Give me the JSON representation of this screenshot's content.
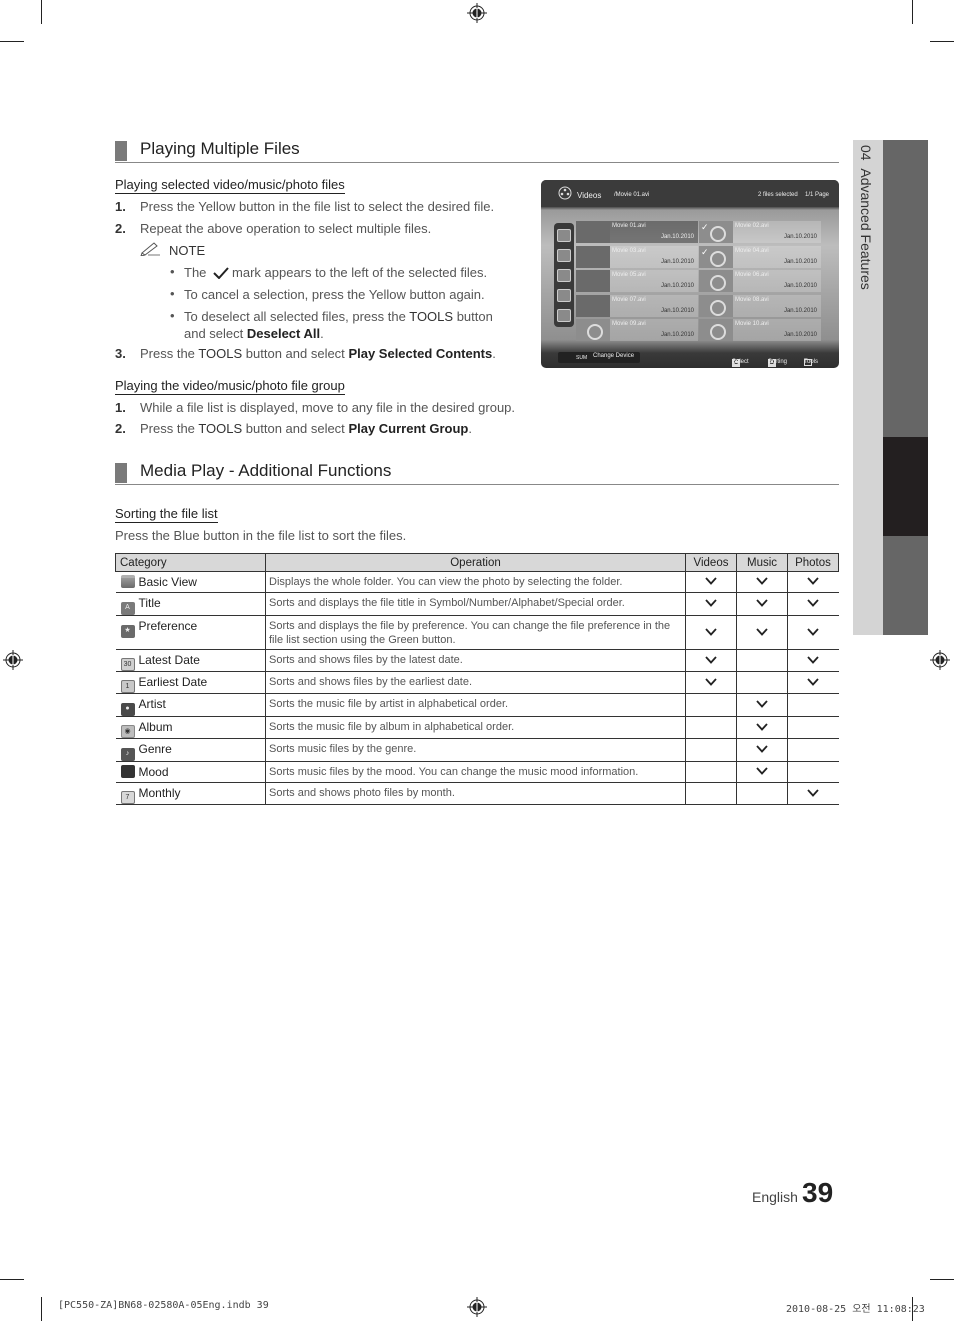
{
  "side_tab": {
    "chapter": "04",
    "title": "Advanced Features"
  },
  "section1": {
    "title": "Playing Multiple Files",
    "sub1": {
      "heading": "Playing selected video/music/photo files",
      "steps": [
        {
          "num": "1.",
          "text": "Press the Yellow button in the file list to select the desired file."
        },
        {
          "num": "2.",
          "text": "Repeat the above operation to select multiple files."
        }
      ],
      "note_label": "NOTE",
      "notes": [
        {
          "pre": "The",
          "post": "mark appears to the left of the selected files."
        },
        {
          "text": "To cancel a selection, press the Yellow button again."
        },
        {
          "pre": "To deselect all selected files, press the",
          "kw": "TOOLS",
          "post": "button",
          "line2_pre": "and select",
          "line2_bold": "Deselect All",
          "line2_post": "."
        }
      ],
      "step3": {
        "num": "3.",
        "pre": "Press the",
        "kw": "TOOLS",
        "mid": "button and select",
        "bold": "Play Selected Contents",
        "post": "."
      }
    },
    "sub2": {
      "heading": "Playing the video/music/photo file group",
      "step1": {
        "num": "1.",
        "text": "While a file list is displayed, move to any file in the desired group."
      },
      "step2": {
        "num": "2.",
        "pre": "Press the",
        "kw": "TOOLS",
        "mid": "button and select",
        "bold": "Play Current Group",
        "post": "."
      }
    }
  },
  "tv_screen": {
    "title": "Videos",
    "path": "/Movie 01.avi",
    "selected_count": "2 files selected",
    "page": "1/1 Page",
    "files": [
      {
        "name": "Movie 01.avi",
        "date": "Jan.10.2010",
        "checked": false
      },
      {
        "name": "Movie 02.avi",
        "date": "Jan.10.2010",
        "checked": true
      },
      {
        "name": "Movie 03.avi",
        "date": "Jan.10.2010",
        "checked": false
      },
      {
        "name": "Movie 04.avi",
        "date": "Jan.10.2010",
        "checked": true
      },
      {
        "name": "Movie 05.avi",
        "date": "Jan.10.2010",
        "checked": false
      },
      {
        "name": "Movie 06.avi",
        "date": "Jan.10.2010",
        "checked": false
      },
      {
        "name": "Movie 07.avi",
        "date": "Jan.10.2010",
        "checked": false
      },
      {
        "name": "Movie 08.avi",
        "date": "Jan.10.2010",
        "checked": false
      },
      {
        "name": "Movie 09.avi",
        "date": "Jan.10.2010",
        "checked": false
      },
      {
        "name": "Movie 10.avi",
        "date": "Jan.10.2010",
        "checked": false
      }
    ],
    "device_label": "SUM",
    "change_device": "Change Device",
    "btn_c": "C",
    "select_label": "Select",
    "btn_d": "D",
    "sorting_label": "Sorting",
    "tools_label": "Tools"
  },
  "section2": {
    "title": "Media Play - Additional Functions",
    "sub_heading": "Sorting the file list",
    "intro": "Press the Blue button in the file list to sort the files.",
    "table": {
      "headers": [
        "Category",
        "Operation",
        "Videos",
        "Music",
        "Photos"
      ],
      "rows": [
        {
          "icon": "folder-icon",
          "category": "Basic View",
          "operation": "Displays the whole folder. You can view the photo by selecting the folder.",
          "videos": true,
          "music": true,
          "photos": true
        },
        {
          "icon": "title-az-icon",
          "category": "Title",
          "operation": "Sorts and displays the file title in Symbol/Number/Alphabet/Special order.",
          "videos": true,
          "music": true,
          "photos": true
        },
        {
          "icon": "star-icon",
          "category": "Preference",
          "operation": "Sorts and displays the file by preference. You can change the file preference in the file list section using the Green button.",
          "videos": true,
          "music": true,
          "photos": true
        },
        {
          "icon": "calendar-30-icon",
          "category": "Latest Date",
          "operation": "Sorts and shows files by the latest date.",
          "videos": true,
          "music": false,
          "photos": true
        },
        {
          "icon": "calendar-1-icon",
          "category": "Earliest Date",
          "operation": "Sorts and shows files by the earliest date.",
          "videos": true,
          "music": false,
          "photos": true
        },
        {
          "icon": "artist-icon",
          "category": "Artist",
          "operation": "Sorts the music file by artist in alphabetical order.",
          "videos": false,
          "music": true,
          "photos": false
        },
        {
          "icon": "album-icon",
          "category": "Album",
          "operation": "Sorts the music file by album in alphabetical order.",
          "videos": false,
          "music": true,
          "photos": false
        },
        {
          "icon": "genre-guitar-icon",
          "category": "Genre",
          "operation": "Sorts music files by the genre.",
          "videos": false,
          "music": true,
          "photos": false
        },
        {
          "icon": "mood-icon",
          "category": "Mood",
          "operation": "Sorts music files by the mood. You can change the music mood information.",
          "videos": false,
          "music": true,
          "photos": false
        },
        {
          "icon": "calendar-month-icon",
          "category": "Monthly",
          "operation": "Sorts and shows photo files by month.",
          "videos": false,
          "music": false,
          "photos": true
        }
      ]
    }
  },
  "footer": {
    "language": "English",
    "page_number": "39",
    "imprint_left": "[PC550-ZA]BN68-02580A-05Eng.indb   39",
    "imprint_right": "2010-08-25   오전 11:08:23"
  }
}
